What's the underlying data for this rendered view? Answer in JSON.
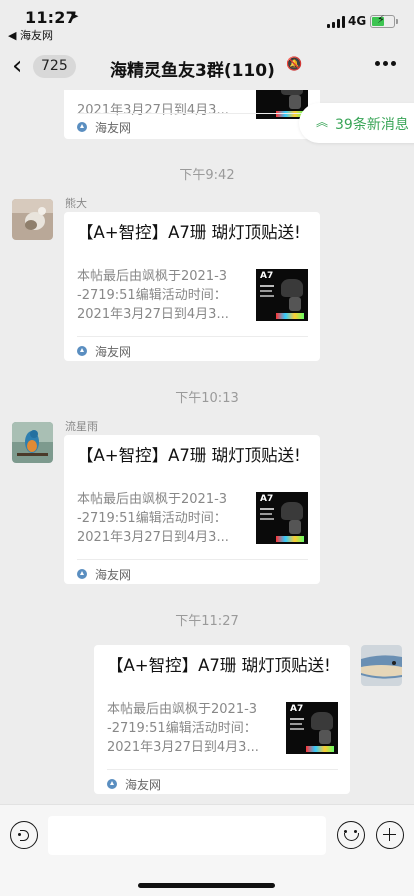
{
  "status_bar": {
    "time": "11:27",
    "location_arrow": "➤",
    "back_app": "◀ 海友网",
    "network": "4G",
    "battery_percent": 55,
    "battery_charging": "⚡"
  },
  "nav": {
    "unread_count": "725",
    "title": "海精灵鱼友3群(110)",
    "back_icon": "chevron-left-icon",
    "mute_icon": "bell-off-icon",
    "more_icon": "ellipsis-icon"
  },
  "new_messages": {
    "arrow": "︽",
    "label": "39条新消息"
  },
  "link_card": {
    "title": "【A+智控】A7珊 瑚灯顶贴送!",
    "description": "本帖最后由飒枫于2021-3\n-2719:51编辑活动时间：\n2021年3月27日到4月3...",
    "thumbnail_text": "A7",
    "source": "海友网"
  },
  "messages": [
    {
      "kind": "partial_card",
      "description_tail": "2021年3月27日到4月3...",
      "source": "海友网"
    },
    {
      "time": "下午9:42",
      "sender": "熊大",
      "side": "left"
    },
    {
      "time": "下午10:13",
      "sender": "流星雨",
      "side": "left"
    },
    {
      "time": "下午11:27",
      "sender": "",
      "side": "right"
    }
  ],
  "input": {
    "value": "",
    "voice_icon": "voice-icon",
    "emoji_icon": "emoji-icon",
    "plus_icon": "plus-icon"
  },
  "colors": {
    "background": "#ededed",
    "accent_green": "#3aa558",
    "card_bg": "#ffffff"
  }
}
